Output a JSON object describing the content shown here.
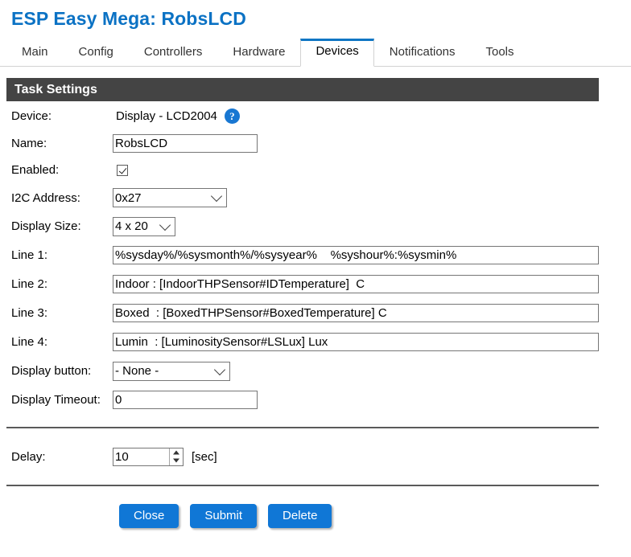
{
  "header": {
    "title": "ESP Easy Mega: RobsLCD"
  },
  "tabs": [
    {
      "label": "Main",
      "active": false
    },
    {
      "label": "Config",
      "active": false
    },
    {
      "label": "Controllers",
      "active": false
    },
    {
      "label": "Hardware",
      "active": false
    },
    {
      "label": "Devices",
      "active": true
    },
    {
      "label": "Notifications",
      "active": false
    },
    {
      "label": "Tools",
      "active": false
    }
  ],
  "section": {
    "title": "Task Settings"
  },
  "form": {
    "device": {
      "label": "Device:",
      "value": "Display - LCD2004",
      "help_icon": "question-mark-icon",
      "help_glyph": "?"
    },
    "name": {
      "label": "Name:",
      "value": "RobsLCD",
      "placeholder": ""
    },
    "enabled": {
      "label": "Enabled:",
      "checked": true
    },
    "i2c_address": {
      "label": "I2C Address:",
      "value": "0x27"
    },
    "display_size": {
      "label": "Display Size:",
      "value": "4 x 20"
    },
    "line1": {
      "label": "Line 1:",
      "value": "%sysday%/%sysmonth%/%sysyear%    %syshour%:%sysmin%"
    },
    "line2": {
      "label": "Line 2:",
      "value": "Indoor : [IndoorTHPSensor#IDTemperature]  C"
    },
    "line3": {
      "label": "Line 3:",
      "value": "Boxed  : [BoxedTHPSensor#BoxedTemperature] C"
    },
    "line4": {
      "label": "Line 4:",
      "value": "Lumin  : [LuminositySensor#LSLux] Lux"
    },
    "display_button": {
      "label": "Display button:",
      "value": "- None -"
    },
    "display_timeout": {
      "label": "Display Timeout:",
      "value": "0"
    },
    "delay": {
      "label": "Delay:",
      "value": "10",
      "unit": "[sec]"
    }
  },
  "buttons": {
    "close": "Close",
    "submit": "Submit",
    "delete": "Delete"
  },
  "colors": {
    "title": "#0b72c4",
    "accent": "#1076c4",
    "section_bar": "#444444",
    "button": "#1077d6"
  }
}
